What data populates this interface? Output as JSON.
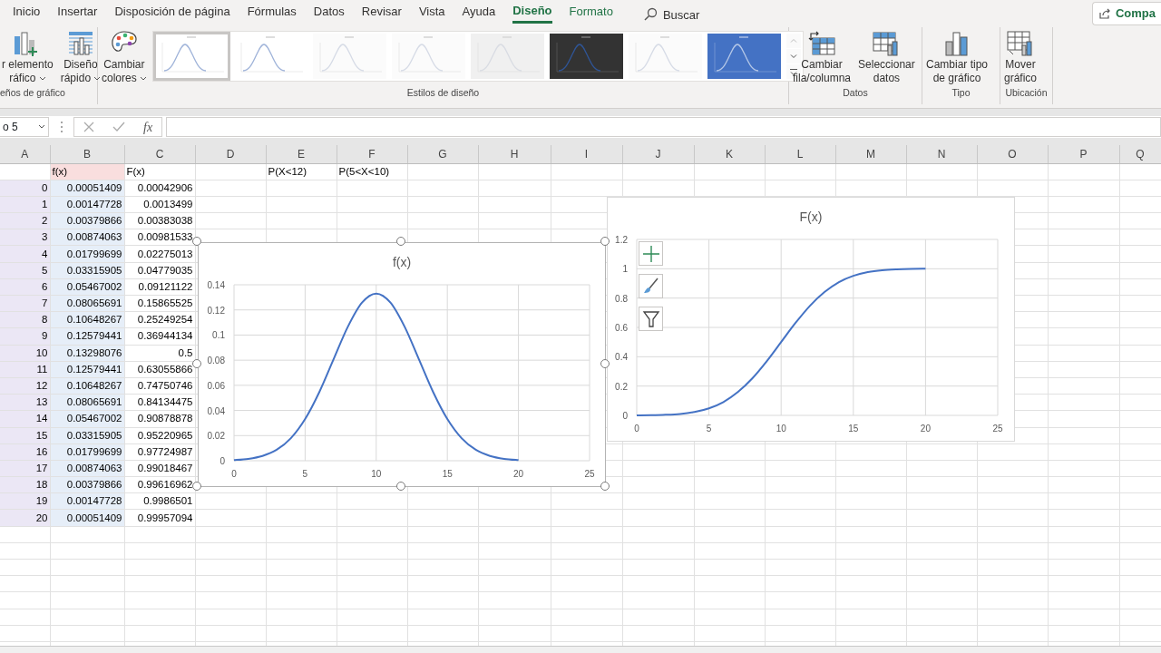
{
  "ribbon_tabs": [
    {
      "label": "Inicio",
      "selected": false,
      "kind": "tab"
    },
    {
      "label": "Insertar",
      "selected": false,
      "kind": "tab"
    },
    {
      "label": "Disposición de página",
      "selected": false,
      "kind": "tab"
    },
    {
      "label": "Fórmulas",
      "selected": false,
      "kind": "tab"
    },
    {
      "label": "Datos",
      "selected": false,
      "kind": "tab"
    },
    {
      "label": "Revisar",
      "selected": false,
      "kind": "tab"
    },
    {
      "label": "Vista",
      "selected": false,
      "kind": "tab"
    },
    {
      "label": "Ayuda",
      "selected": false,
      "kind": "tab"
    },
    {
      "label": "Diseño",
      "selected": true,
      "kind": "context"
    },
    {
      "label": "Formato",
      "selected": false,
      "kind": "context"
    }
  ],
  "search": {
    "label": "Buscar"
  },
  "share_button": {
    "label": "Compa"
  },
  "ribbon_groups": [
    {
      "label": "eños de gráfico",
      "commands": [
        {
          "kind": "add-element",
          "lines": [
            "r elemento",
            "ráfico"
          ],
          "dropdown": true
        },
        {
          "kind": "quick-layout",
          "lines": [
            "Diseño",
            "rápido"
          ],
          "dropdown": true
        }
      ]
    },
    {
      "label": "Estilos de diseño",
      "commands": [
        {
          "kind": "colors",
          "lines": [
            "Cambiar",
            "colores"
          ],
          "dropdown": true
        }
      ],
      "styles": [
        {
          "kind": "light",
          "selected": true
        },
        {
          "kind": "light",
          "selected": false
        },
        {
          "kind": "faint",
          "selected": false
        },
        {
          "kind": "faint",
          "selected": false
        },
        {
          "kind": "grey",
          "selected": false
        },
        {
          "kind": "dark",
          "selected": false
        },
        {
          "kind": "faint",
          "selected": false
        },
        {
          "kind": "blue",
          "selected": false
        }
      ]
    },
    {
      "label": "Datos",
      "commands": [
        {
          "kind": "switch",
          "lines": [
            "Cambiar",
            "fila/columna"
          ],
          "dropdown": false
        },
        {
          "kind": "select-data",
          "lines": [
            "Seleccionar",
            "datos"
          ],
          "dropdown": false
        }
      ]
    },
    {
      "label": "Tipo",
      "commands": [
        {
          "kind": "chart-type",
          "lines": [
            "Cambiar tipo",
            "de gráfico"
          ],
          "dropdown": false
        }
      ]
    },
    {
      "label": "Ubicación",
      "commands": [
        {
          "kind": "move-chart",
          "lines": [
            "Mover",
            "gráfico"
          ],
          "dropdown": false
        }
      ]
    }
  ],
  "formula_bar": {
    "name_box": "o 5",
    "function_button": "fx"
  },
  "sheet": {
    "columns": [
      {
        "label": "A",
        "color": "#ebe7f5"
      },
      {
        "label": "B",
        "color": "#e6eef8"
      },
      {
        "label": "C"
      },
      {
        "label": "D"
      },
      {
        "label": "E"
      },
      {
        "label": "F"
      },
      {
        "label": "G"
      },
      {
        "label": "H"
      },
      {
        "label": "I"
      },
      {
        "label": "J"
      },
      {
        "label": "K"
      },
      {
        "label": "L"
      },
      {
        "label": "M"
      },
      {
        "label": "N"
      },
      {
        "label": "O"
      },
      {
        "label": "P"
      },
      {
        "label": "Q"
      }
    ],
    "rows": [
      {
        "kind": "header",
        "cells": {
          "B": "f(x)",
          "C": "F(x)",
          "E": "P(X<12)",
          "F": "P(5<X<10)"
        }
      },
      {
        "kind": "data",
        "cells": {
          "A": "0",
          "B": "0.00051409",
          "C": "0.00042906"
        }
      },
      {
        "kind": "data",
        "cells": {
          "A": "1",
          "B": "0.00147728",
          "C": "0.0013499"
        }
      },
      {
        "kind": "data",
        "cells": {
          "A": "2",
          "B": "0.00379866",
          "C": "0.00383038"
        }
      },
      {
        "kind": "data",
        "cells": {
          "A": "3",
          "B": "0.00874063",
          "C": "0.00981533"
        }
      },
      {
        "kind": "data",
        "cells": {
          "A": "4",
          "B": "0.01799699",
          "C": "0.02275013"
        }
      },
      {
        "kind": "data",
        "cells": {
          "A": "5",
          "B": "0.03315905",
          "C": "0.04779035"
        }
      },
      {
        "kind": "data",
        "cells": {
          "A": "6",
          "B": "0.05467002",
          "C": "0.09121122"
        }
      },
      {
        "kind": "data",
        "cells": {
          "A": "7",
          "B": "0.08065691",
          "C": "0.15865525"
        }
      },
      {
        "kind": "data",
        "cells": {
          "A": "8",
          "B": "0.10648267",
          "C": "0.25249254"
        }
      },
      {
        "kind": "data",
        "cells": {
          "A": "9",
          "B": "0.12579441",
          "C": "0.36944134"
        }
      },
      {
        "kind": "data",
        "cells": {
          "A": "10",
          "B": "0.13298076",
          "C": "0.5"
        }
      },
      {
        "kind": "data",
        "cells": {
          "A": "11",
          "B": "0.12579441",
          "C": "0.63055866"
        }
      },
      {
        "kind": "data",
        "cells": {
          "A": "12",
          "B": "0.10648267",
          "C": "0.74750746"
        }
      },
      {
        "kind": "data",
        "cells": {
          "A": "13",
          "B": "0.08065691",
          "C": "0.84134475"
        }
      },
      {
        "kind": "data",
        "cells": {
          "A": "14",
          "B": "0.05467002",
          "C": "0.90878878"
        }
      },
      {
        "kind": "data",
        "cells": {
          "A": "15",
          "B": "0.03315905",
          "C": "0.95220965"
        }
      },
      {
        "kind": "data",
        "cells": {
          "A": "16",
          "B": "0.01799699",
          "C": "0.97724987"
        }
      },
      {
        "kind": "data",
        "cells": {
          "A": "17",
          "B": "0.00874063",
          "C": "0.99018467"
        }
      },
      {
        "kind": "data",
        "cells": {
          "A": "18",
          "B": "0.00379866",
          "C": "0.99616962"
        }
      },
      {
        "kind": "data",
        "cells": {
          "A": "19",
          "B": "0.00147728",
          "C": "0.9986501"
        }
      },
      {
        "kind": "data",
        "cells": {
          "A": "20",
          "B": "0.00051409",
          "C": "0.99957094"
        }
      }
    ]
  },
  "charts": [
    {
      "selected": true,
      "chart_data": {
        "type": "line",
        "title": "f(x)",
        "grid": true,
        "x": [
          0,
          1,
          2,
          3,
          4,
          5,
          6,
          7,
          8,
          9,
          10,
          11,
          12,
          13,
          14,
          15,
          16,
          17,
          18,
          19,
          20
        ],
        "series": [
          {
            "color": "#4472c4",
            "values": [
              0.0005,
              0.0015,
              0.0038,
              0.0087,
              0.018,
              0.0332,
              0.0547,
              0.0807,
              0.1065,
              0.1258,
              0.133,
              0.1258,
              0.1065,
              0.0807,
              0.0547,
              0.0332,
              0.018,
              0.0087,
              0.0038,
              0.0015,
              0.0005
            ]
          }
        ],
        "xlim": [
          0,
          25
        ],
        "ylim": [
          0,
          0.14
        ],
        "xticks": [
          {
            "value": 0,
            "label": "0"
          },
          {
            "value": 5,
            "label": "5"
          },
          {
            "value": 10,
            "label": "10"
          },
          {
            "value": 15,
            "label": "15"
          },
          {
            "value": 20,
            "label": "20"
          },
          {
            "value": 25,
            "label": "25"
          }
        ],
        "yticks": [
          {
            "value": 0,
            "label": "0"
          },
          {
            "value": 0.02,
            "label": "0.02"
          },
          {
            "value": 0.04,
            "label": "0.04"
          },
          {
            "value": 0.06,
            "label": "0.06"
          },
          {
            "value": 0.08,
            "label": "0.08"
          },
          {
            "value": 0.1,
            "label": "0.1"
          },
          {
            "value": 0.12,
            "label": "0.12"
          },
          {
            "value": 0.14,
            "label": "0.14"
          }
        ]
      }
    },
    {
      "selected": false,
      "chart_data": {
        "type": "line",
        "title": "F(x)",
        "grid": true,
        "x": [
          0,
          1,
          2,
          3,
          4,
          5,
          6,
          7,
          8,
          9,
          10,
          11,
          12,
          13,
          14,
          15,
          16,
          17,
          18,
          19,
          20
        ],
        "series": [
          {
            "color": "#4472c4",
            "values": [
              0.0,
              0.001,
              0.004,
              0.01,
              0.023,
              0.048,
              0.091,
              0.159,
              0.252,
              0.369,
              0.5,
              0.631,
              0.748,
              0.841,
              0.909,
              0.952,
              0.977,
              0.99,
              0.996,
              0.999,
              1.0
            ]
          }
        ],
        "xlim": [
          0,
          25
        ],
        "ylim": [
          0,
          1.2
        ],
        "xticks": [
          {
            "value": 0,
            "label": "0"
          },
          {
            "value": 5,
            "label": "5"
          },
          {
            "value": 10,
            "label": "10"
          },
          {
            "value": 15,
            "label": "15"
          },
          {
            "value": 20,
            "label": "20"
          },
          {
            "value": 25,
            "label": "25"
          }
        ],
        "yticks": [
          {
            "value": 0,
            "label": "0"
          },
          {
            "value": 0.2,
            "label": "0.2"
          },
          {
            "value": 0.4,
            "label": "0.4"
          },
          {
            "value": 0.6,
            "label": "0.6"
          },
          {
            "value": 0.8,
            "label": "0.8"
          },
          {
            "value": 1,
            "label": "1"
          },
          {
            "value": 1.2,
            "label": "1.2"
          }
        ]
      }
    }
  ],
  "chart_tools": [
    {
      "kind": "elements"
    },
    {
      "kind": "styles"
    },
    {
      "kind": "filter"
    }
  ]
}
